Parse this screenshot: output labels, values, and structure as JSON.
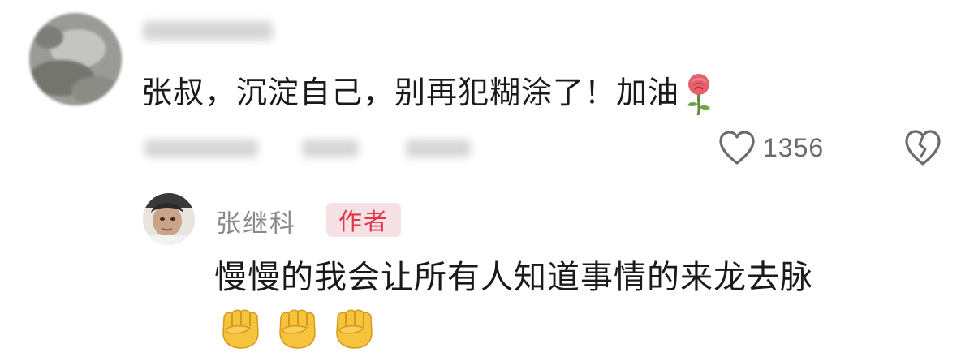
{
  "comment": {
    "avatar_icon": "user-avatar-blurred",
    "text": "张叔，沉淀自己，别再犯糊涂了！加油",
    "emoji_icon": "rose-icon",
    "like_icon": "heart-outline-icon",
    "like_count": "1356",
    "dislike_icon": "broken-heart-icon"
  },
  "reply": {
    "avatar_icon": "author-avatar",
    "author_name": "张继科",
    "author_badge": "作者",
    "text": "慢慢的我会让所有人知道事情的来龙去脉",
    "emoji_icon": "raised-fist-icon",
    "emoji_count": 3
  },
  "colors": {
    "badge_text": "#e2344a",
    "badge_bg": "#f6e2e5",
    "name_gray": "#8a8a8a",
    "count_gray": "#6b6b6b",
    "text_main": "#1a1a1a"
  }
}
